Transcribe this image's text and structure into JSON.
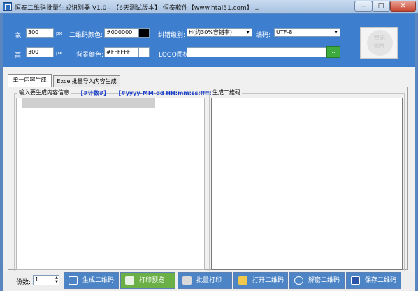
{
  "window": {
    "title": "恒泰二维码批量生成识别器 V1.0 - 【6天测试版本】 恒泰软件【www.htai51.com】 ..",
    "min_glyph": "—",
    "max_glyph": "□",
    "close_glyph": "✕"
  },
  "settings": {
    "width_label": "宽:",
    "width_value": "300",
    "width_unit": "px",
    "height_label": "高:",
    "height_value": "300",
    "height_unit": "px",
    "qr_color_label": "二维码颜色:",
    "qr_color_value": "#000000",
    "qr_color_swatch": "#000000",
    "bg_color_label": "背景颜色:",
    "bg_color_value": "#FFFFFF",
    "bg_color_swatch": "#FFFFFF",
    "ecc_label": "纠错级别:",
    "ecc_value": "H(约30%容错率)",
    "encoding_label": "编码:",
    "encoding_value": "UTF-8",
    "logo_label": "LOGO图标:",
    "logo_value": "",
    "browse_label": "..",
    "preview_text_1": "暂无",
    "preview_text_2": "图片"
  },
  "tabs": [
    {
      "label": "单一内容生成"
    },
    {
      "label": "Excel批量导入内容生成"
    }
  ],
  "input_group": {
    "caption": "输入要生成内容信息",
    "counter_link": "【#计数#】",
    "datetime_link": "【#yyyy-MM-dd HH:mm:ss:ffff#】"
  },
  "output_group": {
    "caption": "生成二维码"
  },
  "bottom": {
    "copies_label": "份数:",
    "copies_value": "1",
    "buttons": [
      {
        "label": "生成二维码",
        "color": "#4c84c6"
      },
      {
        "label": "打印预览",
        "color": "#6ab047"
      },
      {
        "label": "批量打印",
        "color": "#4c84c6"
      },
      {
        "label": "打开二维码",
        "color": "#4c84c6"
      },
      {
        "label": "解密二维码",
        "color": "#4c84c6"
      },
      {
        "label": "保存二维码",
        "color": "#4c84c6"
      }
    ]
  }
}
